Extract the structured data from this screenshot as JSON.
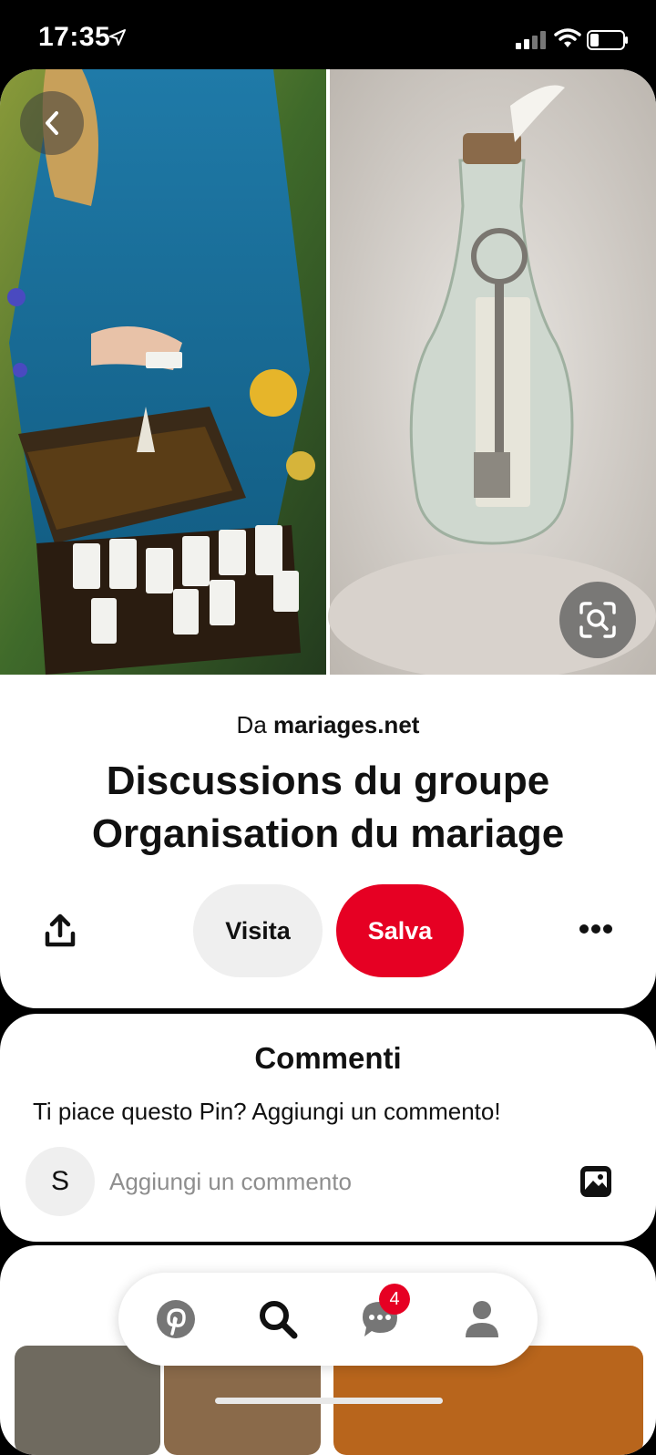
{
  "status_bar": {
    "time": "17:35"
  },
  "pin": {
    "source_prefix": "Da",
    "source_domain": "mariages.net",
    "title": "Discussions du groupe Organisation du mariage",
    "visit_label": "Visita",
    "save_label": "Salva"
  },
  "comments": {
    "title": "Commenti",
    "prompt": "Ti piace questo Pin? Aggiungi un commento!",
    "avatar_initial": "S",
    "placeholder": "Aggiungi un commento"
  },
  "nav": {
    "items": [
      "pinterest-logo",
      "search",
      "messages",
      "profile"
    ],
    "messages_badge": "4"
  },
  "colors": {
    "accent": "#e60023",
    "button_gray": "#efefef"
  }
}
